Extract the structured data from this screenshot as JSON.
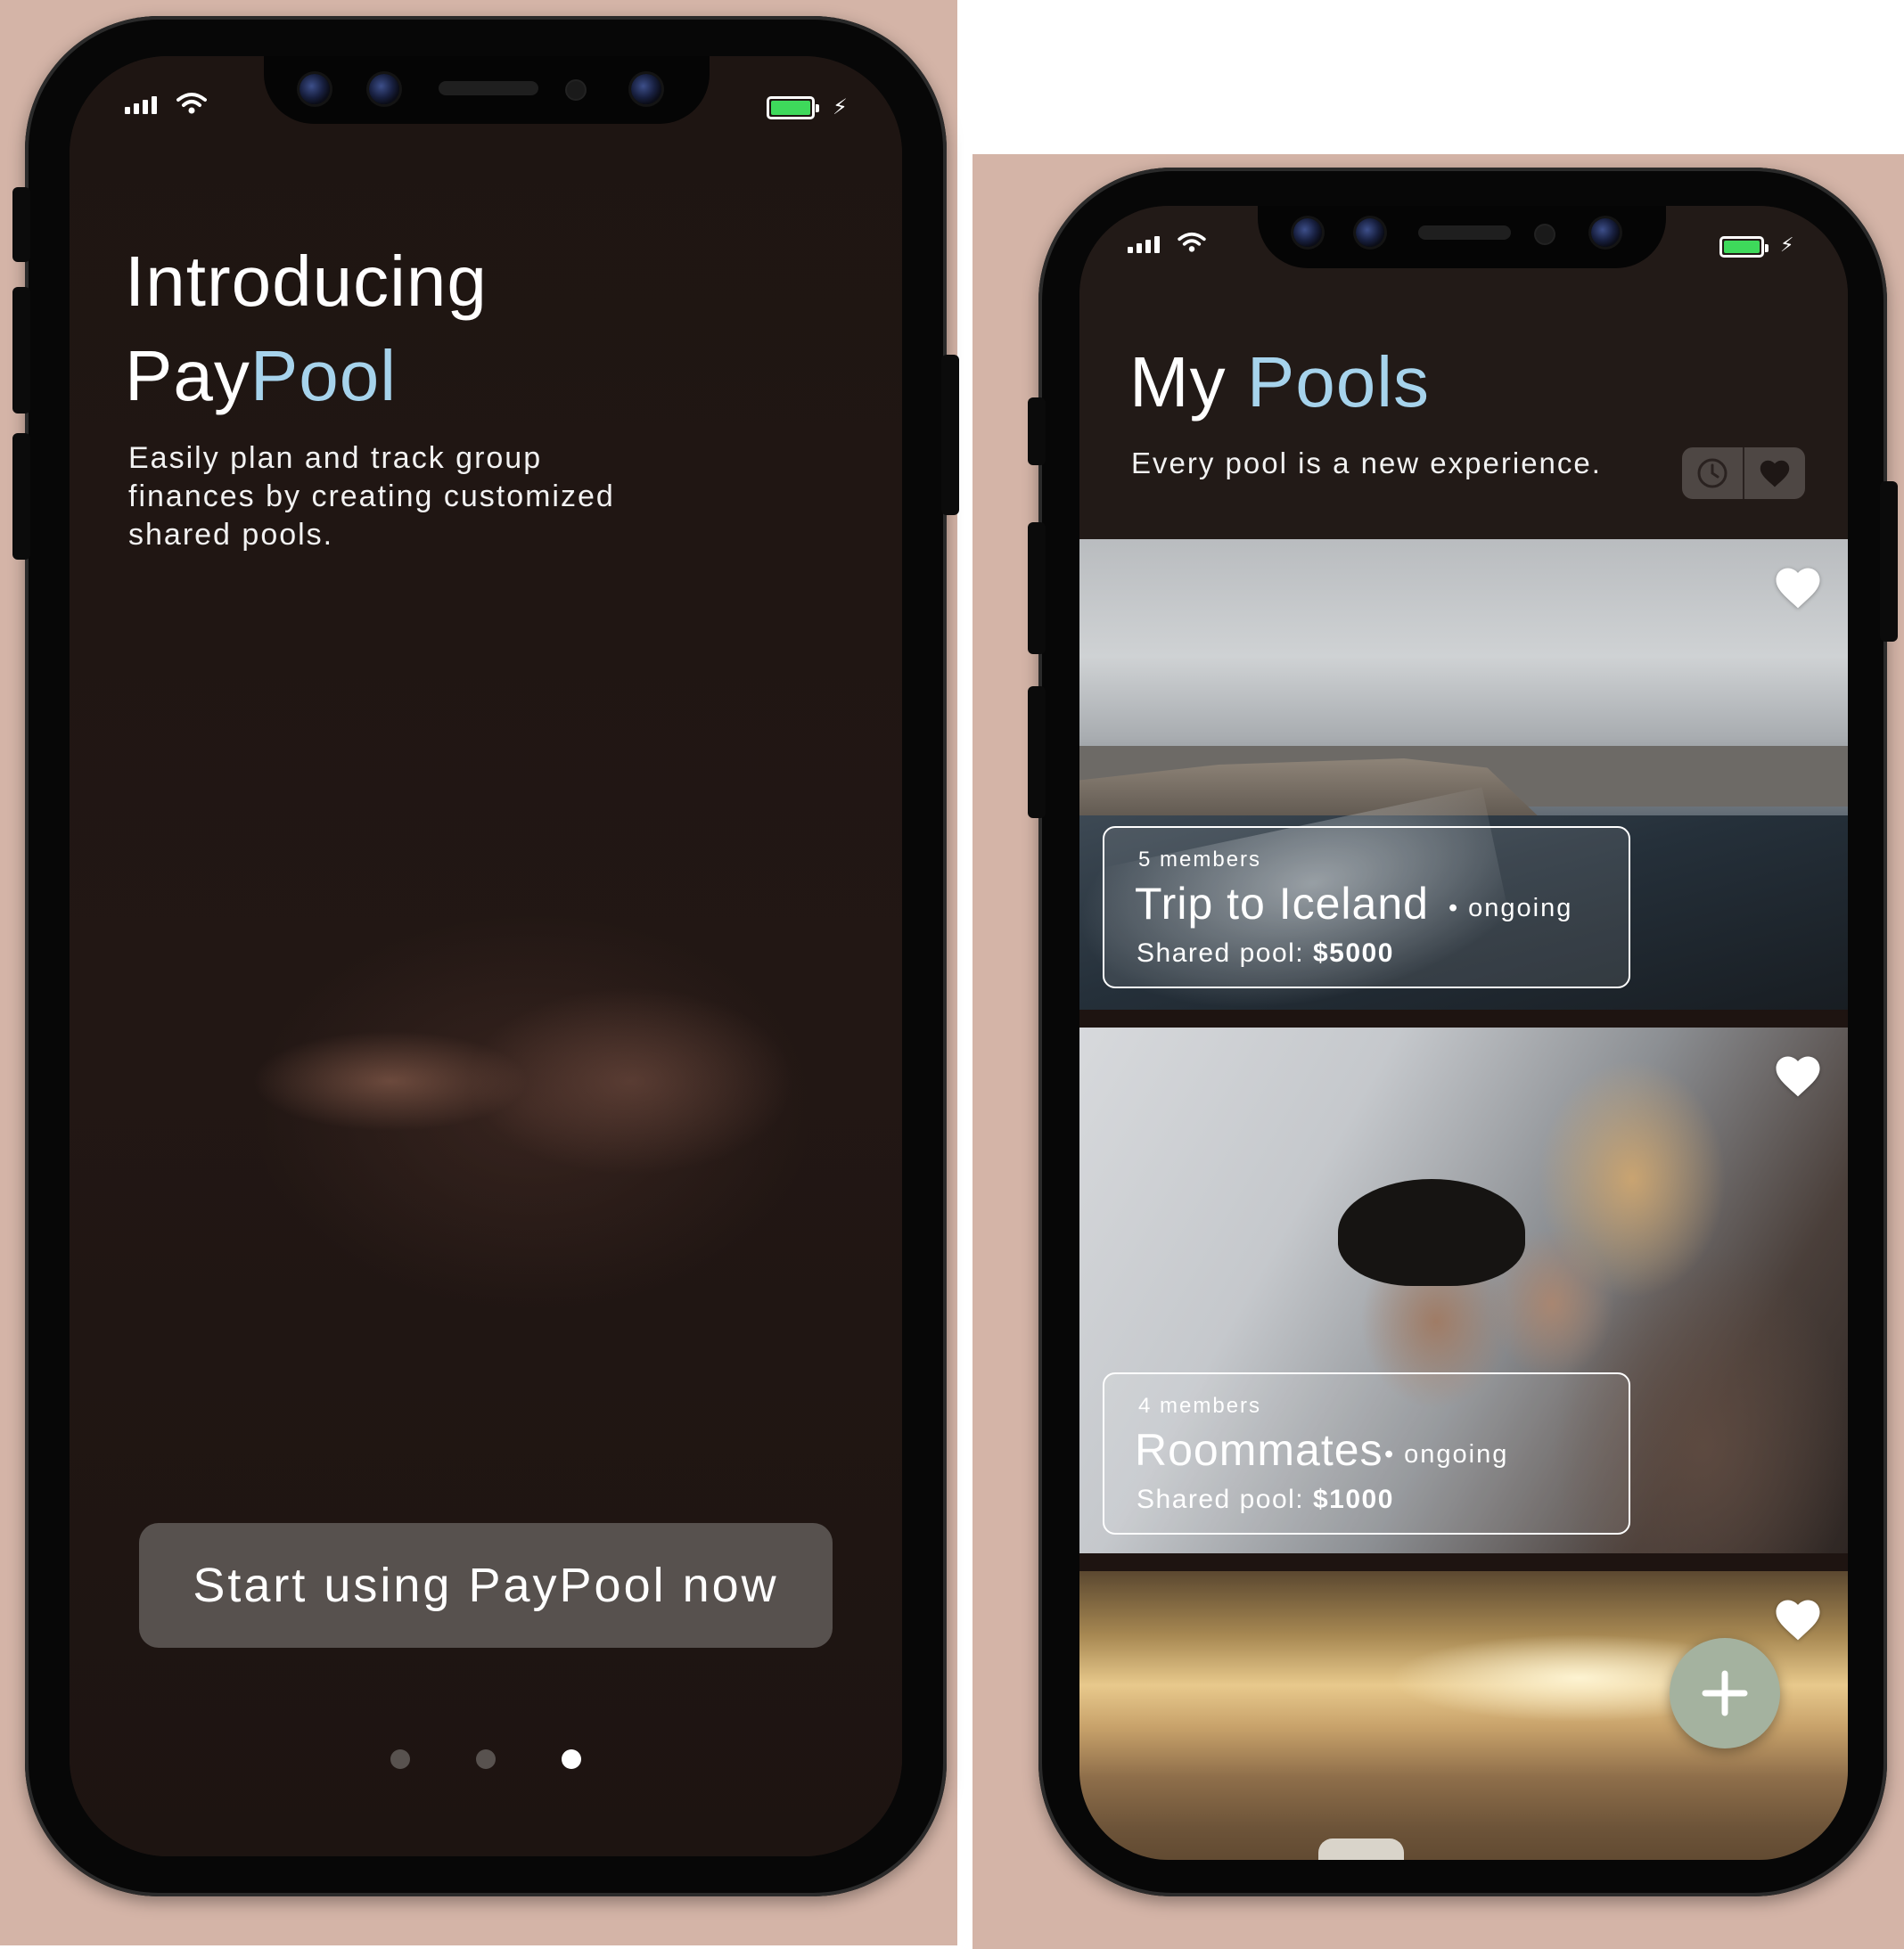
{
  "onboarding": {
    "title_prefix": "Introducing",
    "brand_part1": "Pay",
    "brand_part2": "Pool",
    "subtitle": "Easily plan and track group finances by creating customized shared pools.",
    "cta_label": "Start using PayPool now",
    "pager": {
      "total": 3,
      "active_index": 2
    }
  },
  "pools": {
    "title_part1": "My",
    "title_part2": "Pools",
    "subtitle": "Every pool is a new experience.",
    "toggle": {
      "left_icon": "clock-icon",
      "right_icon": "heart-icon"
    },
    "cards": [
      {
        "members": "5 members",
        "name": "Trip to Iceland",
        "status": "ongoing",
        "pool_label": "Shared pool:",
        "pool_amount": "$5000",
        "favorite": true
      },
      {
        "members": "4 members",
        "name": "Roommates",
        "status": "ongoing",
        "pool_label": "Shared pool:",
        "pool_amount": "$1000",
        "favorite": true
      },
      {
        "favorite": true
      }
    ],
    "fab_icon": "plus-icon"
  },
  "colors": {
    "backdrop": "#d4b4a7",
    "screen_bg": "#1e1411",
    "accent": "#a6d3ec",
    "cta_bg": "#57514e",
    "fab_bg": "#a4b29f",
    "battery_green": "#3ed95b"
  }
}
